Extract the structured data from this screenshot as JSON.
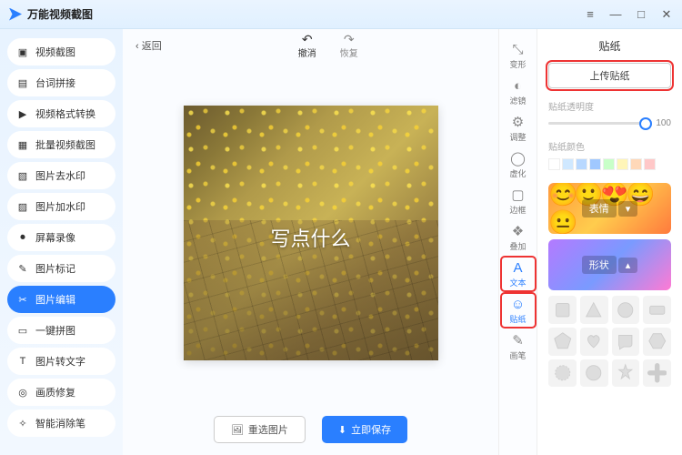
{
  "app": {
    "title": "万能视频截图"
  },
  "window": {
    "menu": "≡",
    "min": "—",
    "max": "□",
    "close": "✕"
  },
  "sidebar": {
    "items": [
      {
        "label": "视频截图",
        "icon": "▣"
      },
      {
        "label": "台词拼接",
        "icon": "▤"
      },
      {
        "label": "视频格式转换",
        "icon": "▶"
      },
      {
        "label": "批量视频截图",
        "icon": "▦"
      },
      {
        "label": "图片去水印",
        "icon": "▧"
      },
      {
        "label": "图片加水印",
        "icon": "▨"
      },
      {
        "label": "屏幕录像",
        "icon": "⏺"
      },
      {
        "label": "图片标记",
        "icon": "✎"
      },
      {
        "label": "图片编辑",
        "icon": "✂"
      },
      {
        "label": "一键拼图",
        "icon": "▭"
      },
      {
        "label": "图片转文字",
        "icon": "T"
      },
      {
        "label": "画质修复",
        "icon": "◎"
      },
      {
        "label": "智能消除笔",
        "icon": "✧"
      }
    ],
    "active_index": 8
  },
  "toolbar": {
    "back": "返回",
    "undo": "撤消",
    "redo": "恢复"
  },
  "canvas": {
    "overlay_text": "写点什么"
  },
  "actions": {
    "reselect": "重选图片",
    "save": "立即保存"
  },
  "toolstrip": {
    "items": [
      {
        "label": "变形",
        "icon": "⤡"
      },
      {
        "label": "滤镜",
        "icon": "◐"
      },
      {
        "label": "调整",
        "icon": "⚙"
      },
      {
        "label": "虚化",
        "icon": "◯"
      },
      {
        "label": "边框",
        "icon": "▢"
      },
      {
        "label": "叠加",
        "icon": "❖"
      },
      {
        "label": "文本",
        "icon": "A"
      },
      {
        "label": "贴纸",
        "icon": "☺"
      },
      {
        "label": "画笔",
        "icon": "✎"
      }
    ],
    "highlight": [
      6,
      7
    ]
  },
  "panel": {
    "title": "贴纸",
    "upload": "上传贴纸",
    "opacity_label": "贴纸透明度",
    "opacity_value": "100",
    "color_label": "贴纸颜色",
    "swatches": [
      "#ffffff",
      "#cfe8ff",
      "#b8d8ff",
      "#a0c8ff",
      "#c8ffc8",
      "#fff5b8",
      "#ffd8b8",
      "#ffc8c8"
    ],
    "cat_emoji": "表情",
    "cat_shape": "形状"
  }
}
